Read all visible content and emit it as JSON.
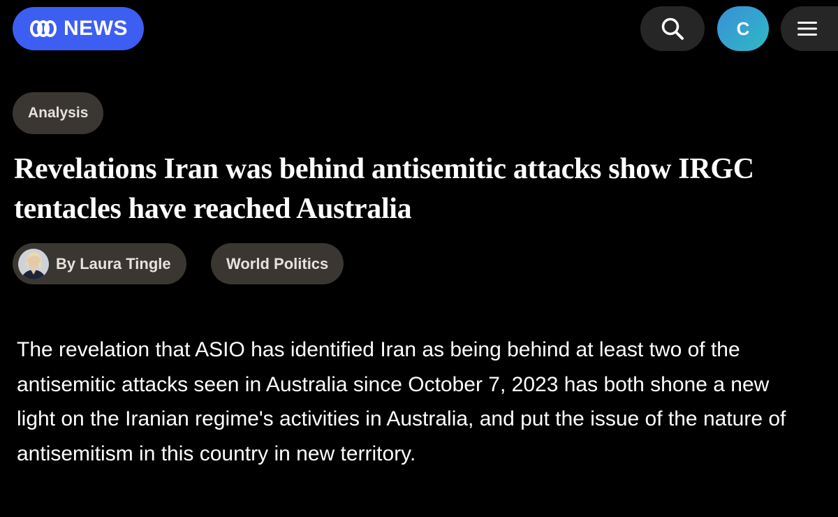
{
  "header": {
    "logo_text": "NEWS",
    "logo_icon": "abc-lissajous-logo",
    "brand_color": "#3d5ef2",
    "search_icon": "search-icon",
    "account_initial": "C",
    "menu_icon": "hamburger-menu-icon"
  },
  "article": {
    "tag": "Analysis",
    "headline": "Revelations Iran was behind antisemitic attacks show IRGC tentacles have reached Australia",
    "byline": "By Laura Tingle",
    "topic": "World Politics",
    "body": "The revelation that ASIO has identified Iran as being behind at least two of the antisemitic attacks seen in Australia since October 7, 2023 has both shone a new light on the Iranian regime's activities in Australia, and put the issue of the nature of antisemitism in this country in new territory."
  },
  "colors": {
    "background": "#000000",
    "pill_background": "#3a3632",
    "header_button": "#262626"
  }
}
